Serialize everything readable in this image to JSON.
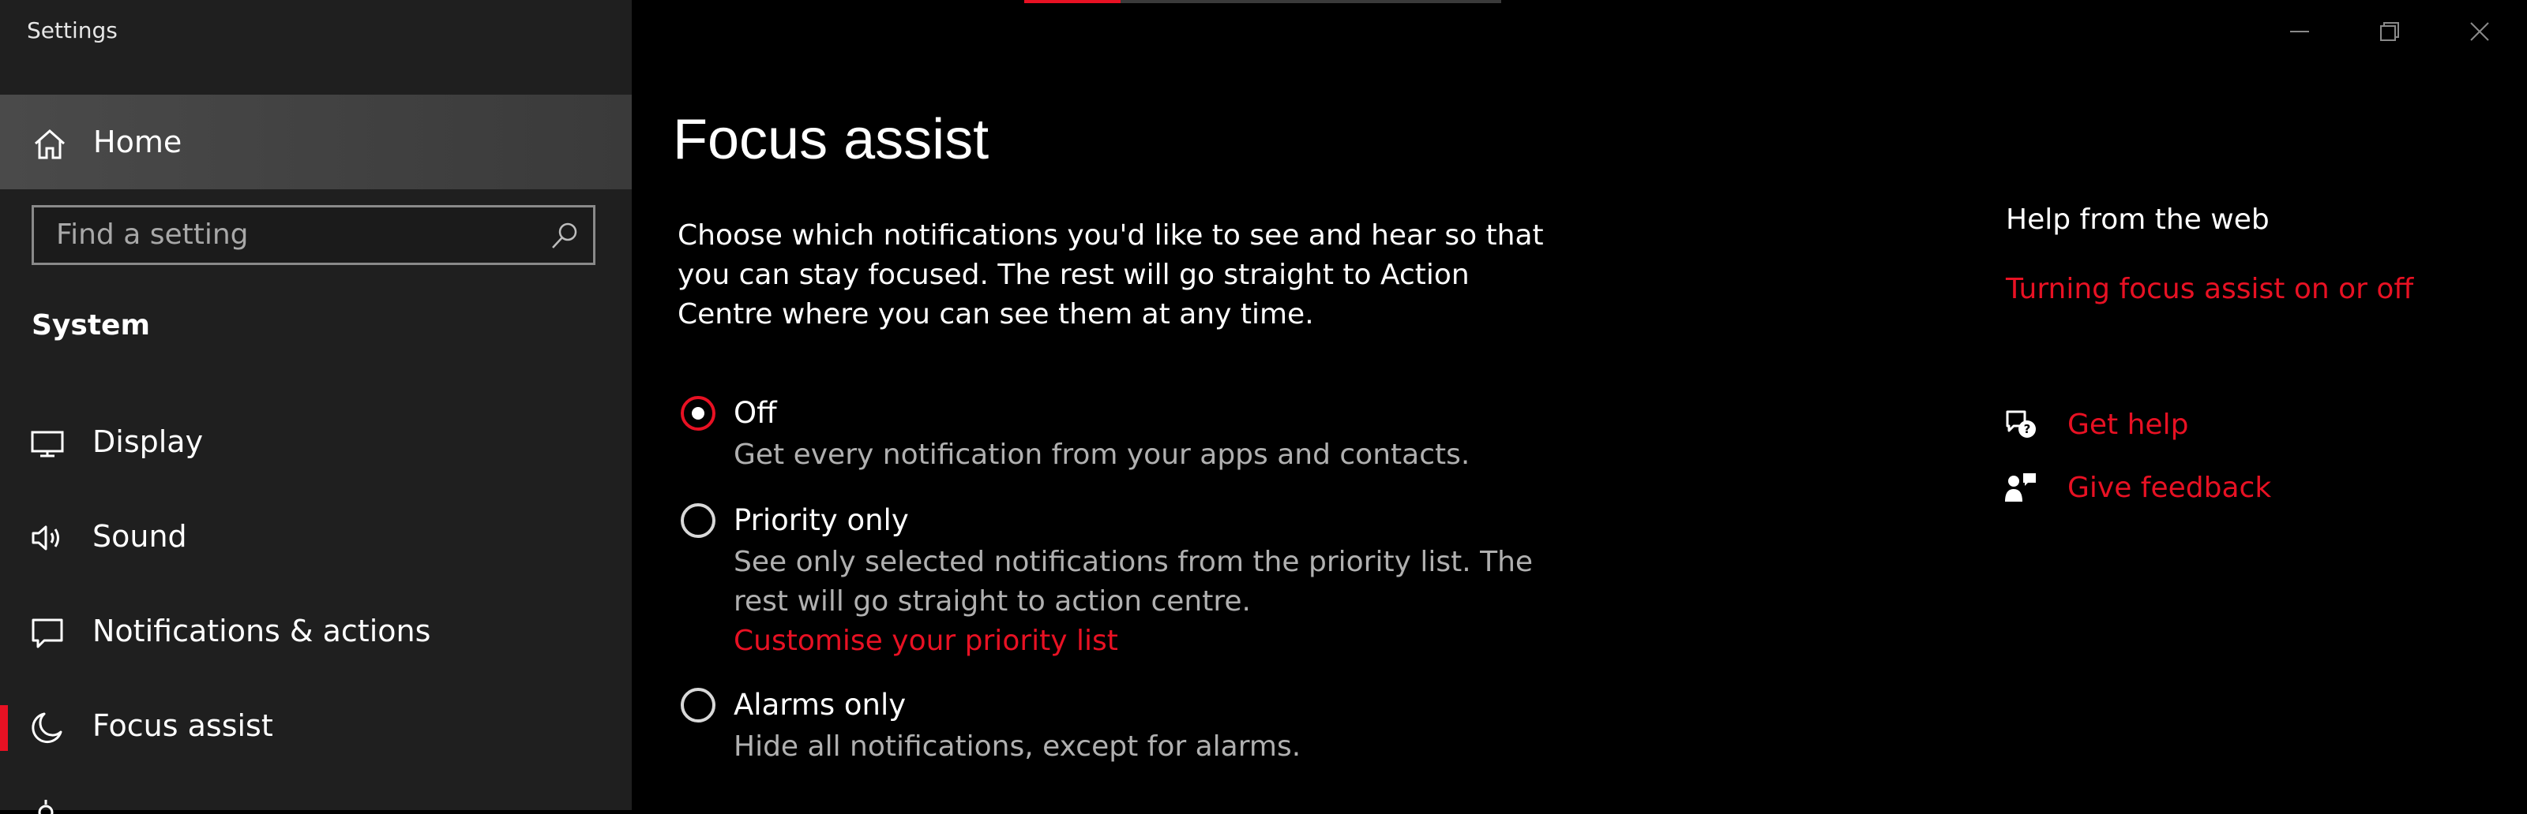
{
  "window": {
    "title": "Settings"
  },
  "sidebar": {
    "home_label": "Home",
    "search_placeholder": "Find a setting",
    "section_label": "System",
    "items": [
      {
        "label": "Display",
        "icon": "display-icon"
      },
      {
        "label": "Sound",
        "icon": "sound-icon"
      },
      {
        "label": "Notifications & actions",
        "icon": "notifications-icon"
      },
      {
        "label": "Focus assist",
        "icon": "moon-icon",
        "active": true
      }
    ]
  },
  "main": {
    "title": "Focus assist",
    "description": "Choose which notifications you'd like to see and hear so that you can stay focused. The rest will go straight to Action Centre where you can see them at any time.",
    "options": [
      {
        "label": "Off",
        "description": "Get every notification from your apps and contacts.",
        "checked": true
      },
      {
        "label": "Priority only",
        "description": "See only selected notifications from the priority list. The rest will go straight to action centre.",
        "link": "Customise your priority list",
        "checked": false
      },
      {
        "label": "Alarms only",
        "description": "Hide all notifications, except for alarms.",
        "checked": false
      }
    ]
  },
  "help": {
    "title": "Help from the web",
    "link": "Turning focus assist on or off",
    "get_help": "Get help",
    "give_feedback": "Give feedback"
  },
  "colors": {
    "accent": "#e81123",
    "sidebar_bg": "#1f1f1f",
    "main_bg": "#000000"
  }
}
